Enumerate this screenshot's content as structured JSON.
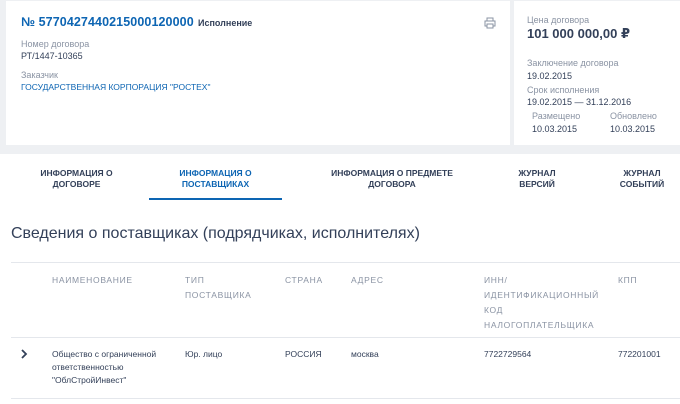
{
  "contract": {
    "number": "№ 5770427440215000120000",
    "status": "Исполнение",
    "contract_number_label": "Номер договора",
    "contract_number_value": "РТ/1447-10365",
    "customer_label": "Заказчик",
    "customer_value": "ГОСУДАРСТВЕННАЯ КОРПОРАЦИЯ \"РОСТЕХ\"",
    "price_label": "Цена договора",
    "price_value": "101 000 000,00 ₽",
    "conclusion_label": "Заключение договора",
    "conclusion_value": "19.02.2015",
    "term_label": "Срок исполнения",
    "term_value": "19.02.2015 — 31.12.2016",
    "placed_label": "Размещено",
    "placed_value": "10.03.2015",
    "updated_label": "Обновлено",
    "updated_value": "10.03.2015"
  },
  "tabs": [
    {
      "line1": "ИНФОРМАЦИЯ О",
      "line2": "ДОГОВОРЕ"
    },
    {
      "line1": "ИНФОРМАЦИЯ О",
      "line2": "ПОСТАВЩИКАХ"
    },
    {
      "line1": "ИНФОРМАЦИЯ О ПРЕДМЕТЕ",
      "line2": "ДОГОВОРА"
    },
    {
      "line1": "ЖУРНАЛ",
      "line2": "ВЕРСИЙ"
    },
    {
      "line1": "ЖУРНАЛ",
      "line2": "СОБЫТИЙ"
    }
  ],
  "section": {
    "title": "Сведения о поставщиках (подрядчиках, исполнителях)"
  },
  "table": {
    "headers": {
      "name": "НАИМЕНОВАНИЕ",
      "type_1": "ТИП",
      "type_2": "ПОСТАВЩИКА",
      "country": "СТРАНА",
      "address": "АДРЕС",
      "inn_1": "ИНН/",
      "inn_2": "ИДЕНТИФИКАЦИОННЫЙ",
      "inn_3": "КОД",
      "inn_4": "НАЛОГОПЛАТЕЛЬЩИКА",
      "kpp": "КПП"
    },
    "rows": [
      {
        "name_1": "Общество с ограниченной",
        "name_2": "ответственностью",
        "name_3": "\"ОблСтройИнвест\"",
        "type": "Юр. лицо",
        "country": "РОССИЯ",
        "address": "москва",
        "inn": "7722729564",
        "kpp": "772201001"
      }
    ]
  },
  "colors": {
    "accent": "#0d65b3",
    "text": "#334059",
    "muted": "#8a93a3",
    "background": "#eef0f3"
  },
  "icons": {
    "print": "printer-icon",
    "expand": "chevron-right-icon"
  }
}
